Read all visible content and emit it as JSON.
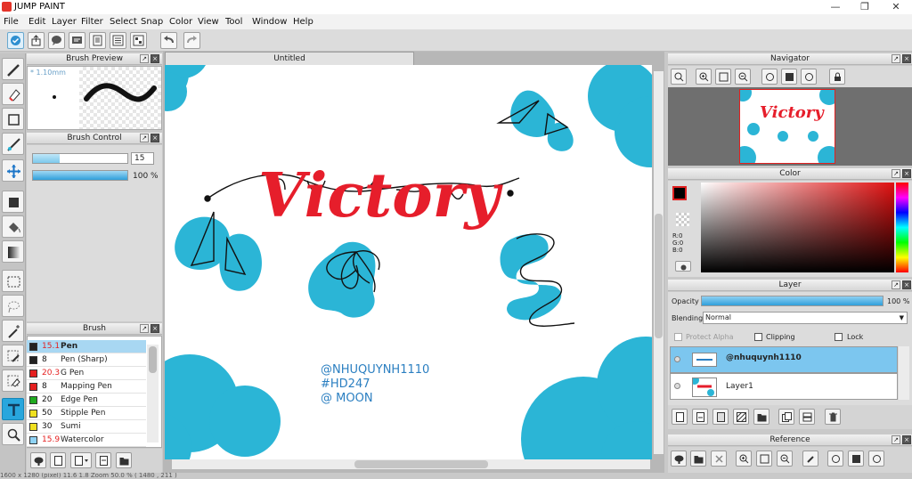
{
  "app": {
    "title": "JUMP PAINT"
  },
  "window_controls": {
    "minimize": "—",
    "maximize": "❐",
    "close": "✕"
  },
  "menu": [
    "File",
    "Edit",
    "Layer",
    "Filter",
    "Select",
    "Snap",
    "Color",
    "View",
    "Tool",
    "Window",
    "Help"
  ],
  "document": {
    "tab_title": "Untitled"
  },
  "brush_preview": {
    "title": "Brush Preview",
    "size_label": "* 1.10mm"
  },
  "brush_control": {
    "title": "Brush Control",
    "size_value": "15",
    "opacity_value": "100 %",
    "size_fill": 0.28,
    "opacity_fill": 1.0
  },
  "brush_panel": {
    "title": "Brush",
    "items": [
      {
        "size": "15.1",
        "name": "Pen",
        "color": "#222222",
        "size_color": "#e52020",
        "selected": true
      },
      {
        "size": "8",
        "name": "Pen (Sharp)",
        "color": "#222222",
        "size_color": "#111111",
        "selected": false
      },
      {
        "size": "20.3",
        "name": "G Pen",
        "color": "#e52020",
        "size_color": "#e52020",
        "selected": false
      },
      {
        "size": "8",
        "name": "Mapping Pen",
        "color": "#e52020",
        "size_color": "#111111",
        "selected": false
      },
      {
        "size": "20",
        "name": "Edge Pen",
        "color": "#1faa1f",
        "size_color": "#111111",
        "selected": false
      },
      {
        "size": "50",
        "name": "Stipple Pen",
        "color": "#f0e020",
        "size_color": "#111111",
        "selected": false
      },
      {
        "size": "30",
        "name": "Sumi",
        "color": "#f0e020",
        "size_color": "#111111",
        "selected": false
      },
      {
        "size": "15.9",
        "name": "Watercolor",
        "color": "#8fd3f5",
        "size_color": "#e52020",
        "selected": false
      }
    ]
  },
  "navigator": {
    "title": "Navigator"
  },
  "color_panel": {
    "title": "Color",
    "r": "R:0",
    "g": "G:0",
    "b": "B:0"
  },
  "layer_panel": {
    "title": "Layer",
    "opacity_label": "Opacity",
    "opacity_value": "100 %",
    "opacity_fill": 1.0,
    "blending_label": "Blending",
    "blending_value": "Normal",
    "protect_alpha": "Protect Alpha",
    "clipping": "Clipping",
    "lock": "Lock",
    "layers": [
      {
        "name": "@nhuquynh1110",
        "selected": true
      },
      {
        "name": "Layer1",
        "selected": false
      }
    ]
  },
  "reference_panel": {
    "title": "Reference"
  },
  "canvas_art": {
    "title_text": "Victory",
    "credit_lines": [
      "@NHUQUYNH1110",
      "#HD247",
      "@ MOON"
    ],
    "brand_color": "#e61e2b",
    "accent_color": "#2bb5d6"
  },
  "statusbar": {
    "text": "1600 x 1280   (pixel) 11.6 1.8 Zoom 50.0 %   ( 1480 , 211 )"
  }
}
